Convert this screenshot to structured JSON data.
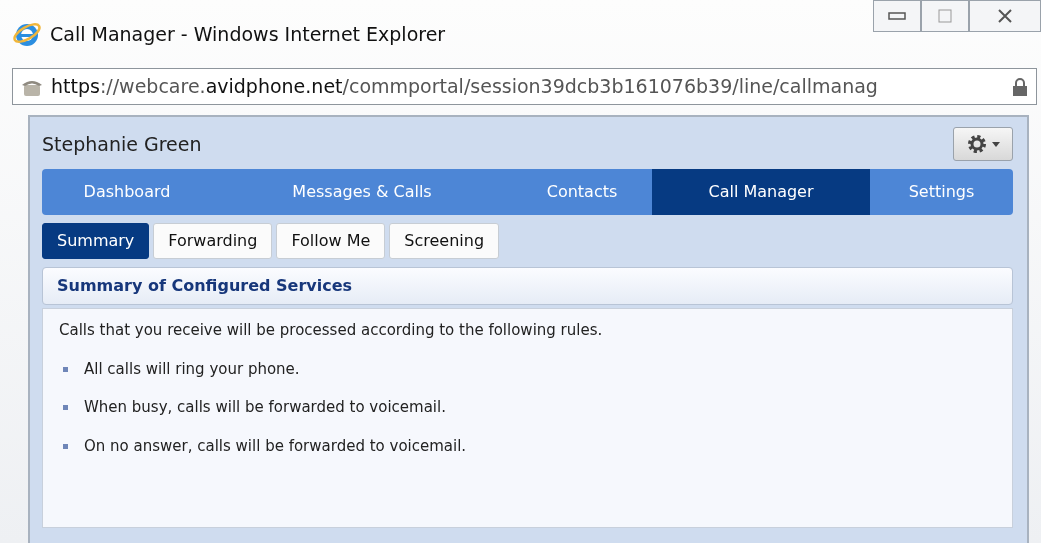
{
  "window": {
    "title": "Call Manager - Windows Internet Explorer"
  },
  "address_bar": {
    "url": "**https**://webcare.**avidphone.net**/commportal/session39dcb3b161076b39/line/callmanag"
  },
  "header": {
    "user_name": "Stephanie Green"
  },
  "nav_tabs": [
    {
      "label": "Dashboard",
      "selected": false
    },
    {
      "label": "Messages & Calls",
      "selected": false
    },
    {
      "label": "Contacts",
      "selected": false
    },
    {
      "label": "Call Manager",
      "selected": true
    },
    {
      "label": "Settings",
      "selected": false
    }
  ],
  "sub_tabs": [
    {
      "label": "Summary",
      "selected": true
    },
    {
      "label": "Forwarding",
      "selected": false
    },
    {
      "label": "Follow Me",
      "selected": false
    },
    {
      "label": "Screening",
      "selected": false
    }
  ],
  "section": {
    "title": "Summary of Configured Services",
    "intro": "Calls that you receive will be processed according to the following rules.",
    "rules": [
      "All calls will ring your phone.",
      "When busy, calls will be forwarded to voicemail.",
      "On no answer, calls will be forwarded to voicemail."
    ]
  }
}
